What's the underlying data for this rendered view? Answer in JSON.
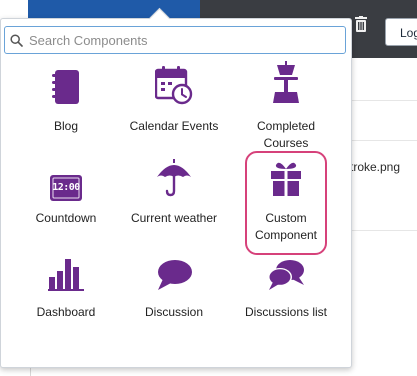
{
  "background": {
    "logout_label": "Log",
    "file_name": "troke.png",
    "trash_icon": "trash-icon"
  },
  "search": {
    "placeholder": "Search Components",
    "value": "",
    "icon": "search-icon"
  },
  "components": [
    {
      "label": "Blog",
      "icon": "notebook-icon"
    },
    {
      "label": "Calendar Events",
      "icon": "calendar-clock-icon"
    },
    {
      "label": "Completed Courses",
      "icon": "podium-icon"
    },
    {
      "label": "Countdown",
      "icon": "digital-clock-icon"
    },
    {
      "label": "Current weather",
      "icon": "umbrella-icon"
    },
    {
      "label": "Custom Component",
      "icon": "gift-icon"
    },
    {
      "label": "Dashboard",
      "icon": "bar-chart-icon"
    },
    {
      "label": "Discussion",
      "icon": "speech-bubble-icon"
    },
    {
      "label": "Discussions list",
      "icon": "speech-bubbles-icon"
    }
  ],
  "digital_clock_text": "12:00",
  "colors": {
    "icon_purple": "#6a2a8c",
    "highlight_pink": "#d6417a",
    "top_blue": "#1f5aa8"
  }
}
